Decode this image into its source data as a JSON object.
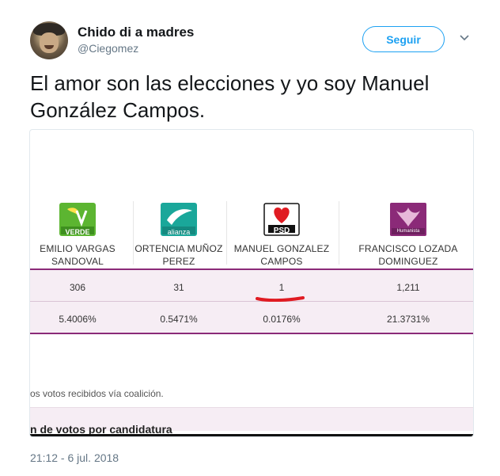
{
  "tweet": {
    "user_name": "Chido di a madres",
    "user_handle": "@Ciegomez",
    "follow_label": "Seguir",
    "text": "El amor son las elecciones y yo soy Manuel González Campos.",
    "timestamp": "21:12 - 6 jul. 2018"
  },
  "media": {
    "candidates": [
      {
        "party": "VERDE",
        "name_line1": "EMILIO VARGAS",
        "name_line2": "SANDOVAL",
        "votes": "306",
        "percent": "5.4006%",
        "color": "#5cb531"
      },
      {
        "party": "alianza",
        "name_line1": "ORTENCIA MUÑOZ",
        "name_line2": "PEREZ",
        "votes": "31",
        "percent": "0.5471%",
        "color": "#1aa79a"
      },
      {
        "party": "PSD",
        "name_line1": "MANUEL GONZALEZ",
        "name_line2": "CAMPOS",
        "votes": "1",
        "percent": "0.0176%",
        "color": "#e01b22"
      },
      {
        "party": "Humanista",
        "name_line1": "FRANCISCO LOZADA",
        "name_line2": "DOMINGUEZ",
        "votes": "1,211",
        "percent": "21.3731%",
        "color": "#8b2a78"
      }
    ],
    "note": "os votos recibidos vía coalición.",
    "section_title": "n de votos por candidatura"
  },
  "colors": {
    "accent": "#1da1f2",
    "table_border": "#8b2a78",
    "highlight": "#e01b22"
  }
}
